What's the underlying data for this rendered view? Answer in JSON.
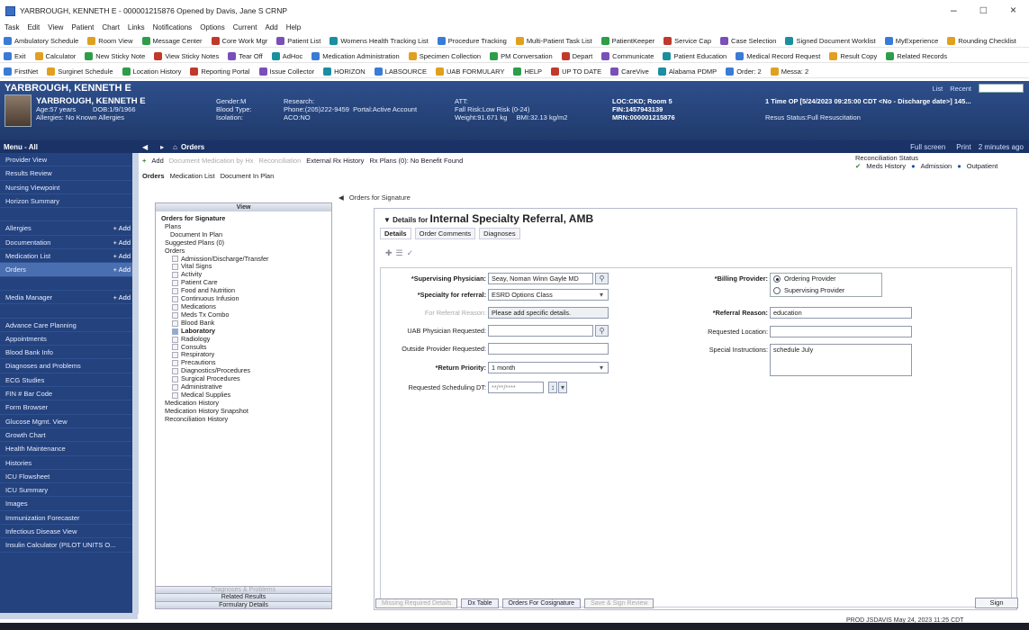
{
  "window": {
    "title": "YARBROUGH, KENNETH E - 000001215876 Opened by Davis, Jane S CRNP",
    "minimize": "–",
    "maximize": "□",
    "close": "×"
  },
  "menu": [
    "Task",
    "Edit",
    "View",
    "Patient",
    "Chart",
    "Links",
    "Notifications",
    "Options",
    "Current",
    "Add",
    "Help"
  ],
  "toolbar1": [
    "Ambulatory Schedule",
    "Room View",
    "Message Center",
    "Core Work Mgr",
    "Patient List",
    "Womens Health Tracking List",
    "Procedure Tracking",
    "Multi-Patient Task List",
    "PatientKeeper",
    "Service Cap",
    "Case Selection",
    "Signed Document Worklist",
    "MyExperience",
    "Rounding Checklist"
  ],
  "toolbar2": [
    "Exit",
    "Calculator",
    "New Sticky Note",
    "View Sticky Notes",
    "Tear Off",
    "AdHoc",
    "Medication Administration",
    "Specimen Collection",
    "PM Conversation",
    "Depart",
    "Communicate",
    "Patient Education",
    "Medical Record Request",
    "Result Copy",
    "Related Records"
  ],
  "toolbar3": [
    "FirstNet",
    "Surginet Schedule",
    "Location History",
    "Reporting Portal",
    "Issue Collector",
    "HORIZON",
    "LABSOURCE",
    "UAB FORMULARY",
    "HELP",
    "UP TO DATE",
    "CareVive",
    "Alabama PDMP",
    "Order: 2",
    "Messa: 2"
  ],
  "banner": {
    "tab_name": "YARBROUGH, KENNETH E",
    "list": "List",
    "recent": "Recent",
    "name": "YARBROUGH, KENNETH E",
    "age": "Age:57 years",
    "dob": "DOB:1/9/1966",
    "allergies": "Allergies: No Known Allergies",
    "gender": "Gender:M",
    "blood_type": "Blood Type:",
    "isolation": "Isolation:",
    "research": "Research:",
    "phone": "Phone:(205)222-9459",
    "portal": "Portal:Active Account",
    "aco": "ACO:NO",
    "att": "ATT:",
    "fall": "Fall Risk:Low Risk (0-24)",
    "weight": "Weight:91.671 kg",
    "bmi": "BMI:32.13 kg/m2",
    "loc": "LOC:CKD; Room 5",
    "fin": "FIN:1457943139",
    "mrn": "MRN:000001215876",
    "encounter": "1 Time OP [5/24/2023 09:25:00 CDT <No - Discharge date>] 145...",
    "resus": "Resus Status:Full Resuscitation"
  },
  "subbar": {
    "menu": "Menu - All",
    "orders": "Orders",
    "full_screen": "Full screen",
    "print": "Print",
    "ago": "2 minutes ago"
  },
  "leftnav": [
    {
      "label": "Provider View",
      "add": ""
    },
    {
      "label": "Results Review",
      "add": ""
    },
    {
      "label": "Nursing Viewpoint",
      "add": ""
    },
    {
      "label": "Horizon Summary",
      "add": ""
    },
    {
      "label": "",
      "add": ""
    },
    {
      "label": "Allergies",
      "add": "+ Add"
    },
    {
      "label": "Documentation",
      "add": "+ Add"
    },
    {
      "label": "Medication List",
      "add": "+ Add"
    },
    {
      "label": "Orders",
      "add": "+ Add"
    },
    {
      "label": "",
      "add": ""
    },
    {
      "label": "Media Manager",
      "add": "+ Add"
    },
    {
      "label": "",
      "add": ""
    },
    {
      "label": "Advance Care Planning",
      "add": ""
    },
    {
      "label": "Appointments",
      "add": ""
    },
    {
      "label": "Blood Bank Info",
      "add": ""
    },
    {
      "label": "Diagnoses and Problems",
      "add": ""
    },
    {
      "label": "ECG Studies",
      "add": ""
    },
    {
      "label": "FIN # Bar Code",
      "add": ""
    },
    {
      "label": "Form Browser",
      "add": ""
    },
    {
      "label": "Glucose Mgmt. View",
      "add": ""
    },
    {
      "label": "Growth Chart",
      "add": ""
    },
    {
      "label": "Health Maintenance",
      "add": ""
    },
    {
      "label": "Histories",
      "add": ""
    },
    {
      "label": "ICU Flowsheet",
      "add": ""
    },
    {
      "label": "ICU Summary",
      "add": ""
    },
    {
      "label": "Images",
      "add": ""
    },
    {
      "label": "Immunization Forecaster",
      "add": ""
    },
    {
      "label": "Infectious Disease View",
      "add": ""
    },
    {
      "label": "Insulin Calculator (PILOT UNITS O...",
      "add": ""
    }
  ],
  "actions": {
    "add": "Add",
    "doc_med": "Document Medication by Hx",
    "recon": "Reconciliation",
    "ext_rx": "External Rx History",
    "rx_plans": "Rx Plans (0): No Benefit Found"
  },
  "recon": {
    "title": "Reconciliation Status",
    "meds": "Meds History",
    "admission": "Admission",
    "outpatient": "Outpatient"
  },
  "tabs": [
    "Orders",
    "Medication List",
    "Document In Plan"
  ],
  "view": {
    "header": "View",
    "tree": [
      {
        "t": "Orders for Signature",
        "k": "h"
      },
      {
        "t": "Plans",
        "k": "i1"
      },
      {
        "t": "Document In Plan",
        "k": "i1b"
      },
      {
        "t": "Suggested Plans (0)",
        "k": "i1"
      },
      {
        "t": "Orders",
        "k": "i1"
      },
      {
        "t": "Admission/Discharge/Transfer",
        "k": "i2"
      },
      {
        "t": "Vital Signs",
        "k": "i2"
      },
      {
        "t": "Activity",
        "k": "i2"
      },
      {
        "t": "Patient Care",
        "k": "i2"
      },
      {
        "t": "Food and Nutrition",
        "k": "i2"
      },
      {
        "t": "Continuous Infusion",
        "k": "i2"
      },
      {
        "t": "Medications",
        "k": "i2"
      },
      {
        "t": "Meds Tx Combo",
        "k": "i2"
      },
      {
        "t": "Blood Bank",
        "k": "i2"
      },
      {
        "t": "Laboratory",
        "k": "i2"
      },
      {
        "t": "Radiology",
        "k": "i2"
      },
      {
        "t": "Consults",
        "k": "i2"
      },
      {
        "t": "Respiratory",
        "k": "i2"
      },
      {
        "t": "Precautions",
        "k": "i2"
      },
      {
        "t": "Diagnostics/Procedures",
        "k": "i2"
      },
      {
        "t": "Surgical Procedures",
        "k": "i2"
      },
      {
        "t": "Administrative",
        "k": "i2"
      },
      {
        "t": "Medical Supplies",
        "k": "i2"
      },
      {
        "t": "Medication History",
        "k": "i1"
      },
      {
        "t": "Medication History Snapshot",
        "k": "i1"
      },
      {
        "t": "Reconciliation History",
        "k": "i1"
      }
    ],
    "bottom": [
      "Diagnoses & Problems",
      "Related Results",
      "Formulary Details"
    ]
  },
  "ofs_label": "Orders for Signature",
  "details": {
    "prefix": "Details for",
    "title": "Internal Specialty Referral, AMB",
    "tabs": [
      "Details",
      "Order Comments",
      "Diagnoses"
    ]
  },
  "form": {
    "supervising_label": "*Supervising Physician:",
    "supervising_value": "Seay, Noman Winn Gayle MD",
    "specialty_label": "*Specialty for referral:",
    "specialty_value": "ESRD Options Class",
    "forref_label": "For Referral Reason:",
    "forref_value": "Please add specific details.",
    "uab_label": "UAB Physician Requested:",
    "outside_label": "Outside Provider Requested:",
    "return_label": "*Return Priority:",
    "return_value": "1 month",
    "sched_label": "Requested Scheduling DT:",
    "sched_value": "**/**/****",
    "billing_label": "*Billing Provider:",
    "billing_opt1": "Ordering Provider",
    "billing_opt2": "Supervising Provider",
    "reason_label": "*Referral Reason:",
    "reason_value": "education",
    "reqloc_label": "Requested Location:",
    "special_label": "Special Instructions:",
    "special_value": "schedule July"
  },
  "footer": {
    "btn1": "Missing Required Details",
    "btn2": "Dx Table",
    "btn3": "Orders For Cosignature",
    "btn4": "Save & Sign Review",
    "sign": "Sign"
  },
  "status": "PROD  JSDAVIS  May 24, 2023  11:25 CDT"
}
